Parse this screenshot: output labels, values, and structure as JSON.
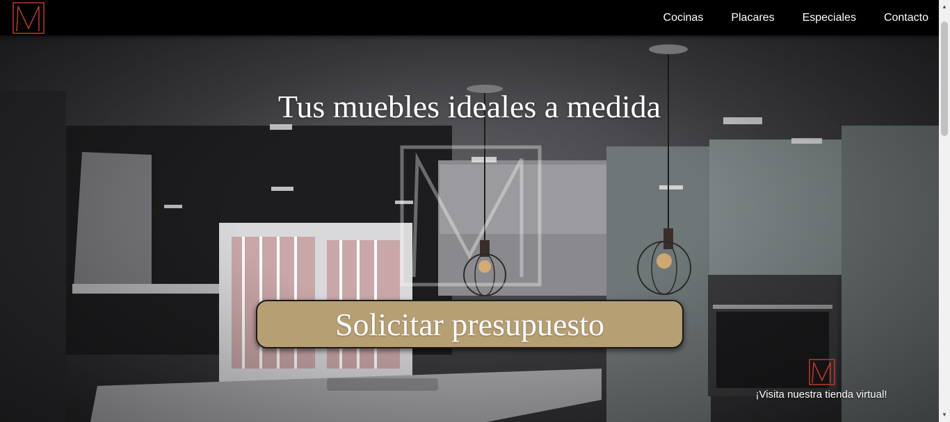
{
  "brand": {
    "logo_icon": "brand-m-logo-icon",
    "accent_color": "#c0392b"
  },
  "nav": {
    "items": [
      {
        "label": "Cocinas"
      },
      {
        "label": "Placares"
      },
      {
        "label": "Especiales"
      },
      {
        "label": "Contacto"
      }
    ]
  },
  "hero": {
    "title": "Tus muebles ideales a medida",
    "cta_label": "Solicitar presupuesto",
    "cta_color": "#b79f74",
    "store_link_label": "¡Visita nuestra tienda virtual!"
  }
}
